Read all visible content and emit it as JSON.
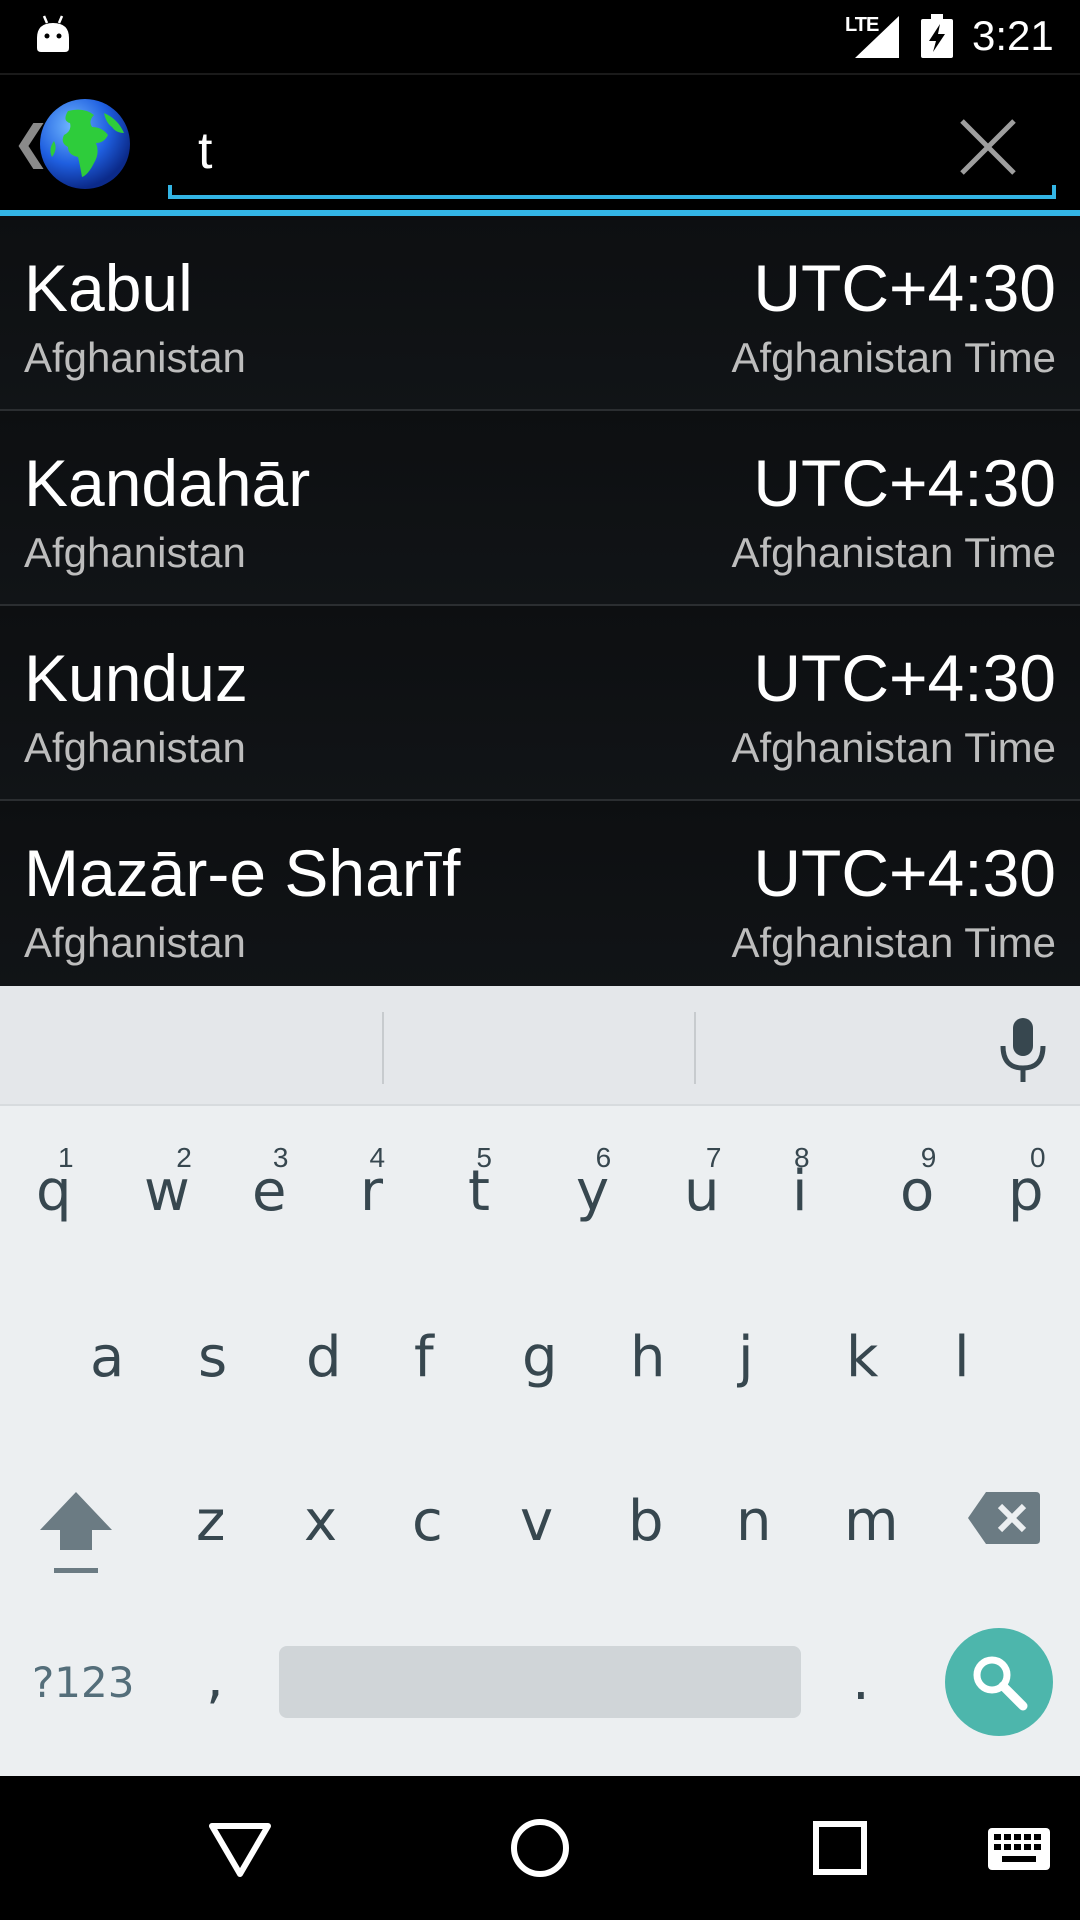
{
  "status_bar": {
    "network": "LTE",
    "time": "3:21"
  },
  "search": {
    "query": "t"
  },
  "results": [
    {
      "city": "Kabul",
      "country": "Afghanistan",
      "offset": "UTC+4:30",
      "zone": "Afghanistan Time"
    },
    {
      "city": "Kandahār",
      "country": "Afghanistan",
      "offset": "UTC+4:30",
      "zone": "Afghanistan Time"
    },
    {
      "city": "Kunduz",
      "country": "Afghanistan",
      "offset": "UTC+4:30",
      "zone": "Afghanistan Time"
    },
    {
      "city": "Mazār-e Sharīf",
      "country": "Afghanistan",
      "offset": "UTC+4:30",
      "zone": "Afghanistan Time"
    }
  ],
  "keyboard": {
    "row1": [
      {
        "key": "q",
        "hint": "1"
      },
      {
        "key": "w",
        "hint": "2"
      },
      {
        "key": "e",
        "hint": "3"
      },
      {
        "key": "r",
        "hint": "4"
      },
      {
        "key": "t",
        "hint": "5"
      },
      {
        "key": "y",
        "hint": "6"
      },
      {
        "key": "u",
        "hint": "7"
      },
      {
        "key": "i",
        "hint": "8"
      },
      {
        "key": "o",
        "hint": "9"
      },
      {
        "key": "p",
        "hint": "0"
      }
    ],
    "row2": [
      "a",
      "s",
      "d",
      "f",
      "g",
      "h",
      "j",
      "k",
      "l"
    ],
    "row3": [
      "z",
      "x",
      "c",
      "v",
      "b",
      "n",
      "m"
    ],
    "symbols_label": "?123",
    "comma": ",",
    "period": "."
  },
  "colors": {
    "accent": "#33b5e5",
    "search_key": "#4db6ac",
    "keyboard_bg": "#eceff1"
  },
  "icons": {
    "status_left": "android-icon",
    "signal": "cell-signal-icon",
    "battery": "battery-charging-icon",
    "app": "globe-icon",
    "clear": "close-icon",
    "mic": "mic-icon",
    "shift": "shift-icon",
    "delete": "backspace-icon",
    "search": "search-icon",
    "nav_back": "back-triangle-icon",
    "nav_home": "home-circle-icon",
    "nav_recents": "recents-square-icon",
    "nav_keyboard": "keyboard-icon"
  }
}
